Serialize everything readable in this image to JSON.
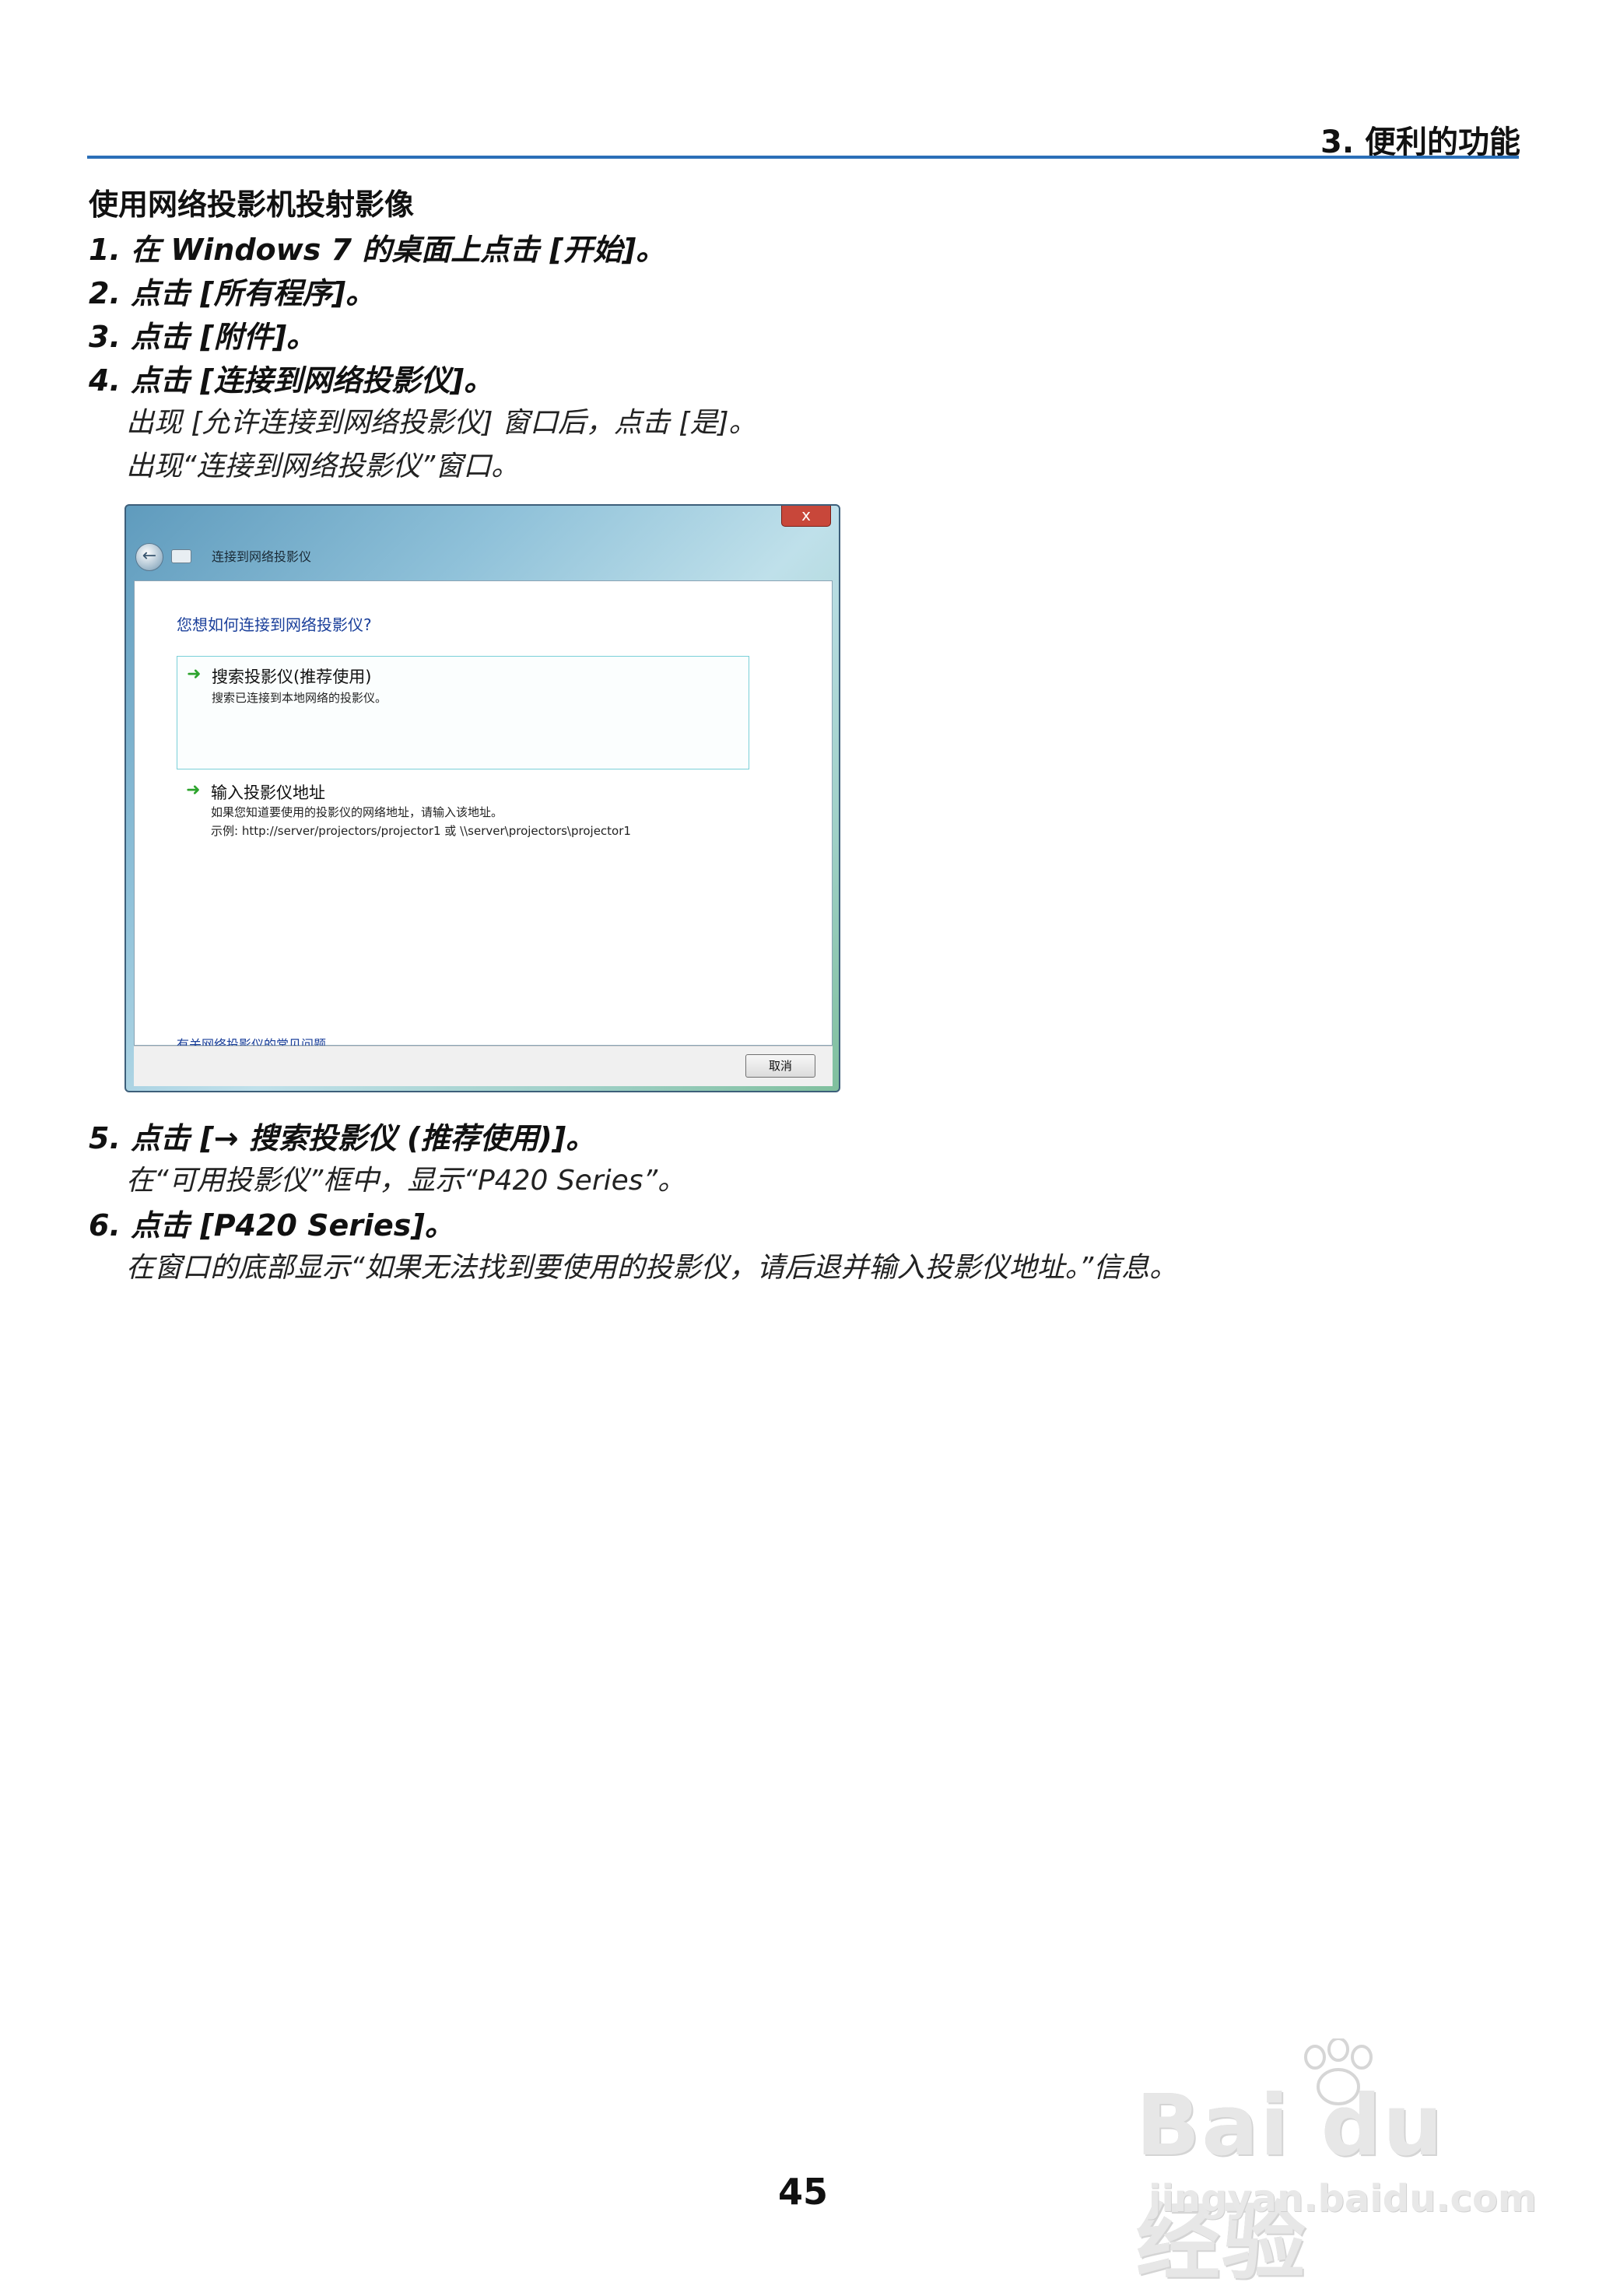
{
  "header": {
    "section": "3. 便利的功能"
  },
  "title": "使用网络投影机投射影像",
  "steps": [
    "1. 在 Windows 7 的桌面上点击 [开始]。",
    "2. 点击 [所有程序]。",
    "3. 点击 [附件]。",
    "4. 点击 [连接到网络投影仪]。",
    "5. 点击 [→ 搜索投影仪 (推荐使用)]。",
    "6. 点击 [P420 Series]。"
  ],
  "step4_sub": [
    "出现 [允许连接到网络投影仪] 窗口后，点击 [是]。",
    "出现“连接到网络投影仪”窗口。"
  ],
  "step5_sub": "在“可用投影仪”框中，显示“P420 Series”。",
  "step6_sub": "在窗口的底部显示“如果无法找到要使用的投影仪，请后退并输入投影仪地址。”信息。",
  "dialog": {
    "close": "x",
    "title": "连接到网络投影仪",
    "question": "您想如何连接到网络投影仪?",
    "option1": {
      "title": "搜索投影仪(推荐使用)",
      "desc": "搜索已连接到本地网络的投影仪。"
    },
    "option2": {
      "title": "输入投影仪地址",
      "desc1": "如果您知道要使用的投影仪的网络地址，请输入该地址。",
      "desc2": "示例: http://server/projectors/projector1 或 \\\\server\\projectors\\projector1"
    },
    "help_link": "有关网络投影仪的常见问题",
    "cancel": "取消"
  },
  "page_number": "45",
  "watermark": {
    "main": "Bai du 经验",
    "sub": "jingyan.baidu.com"
  }
}
